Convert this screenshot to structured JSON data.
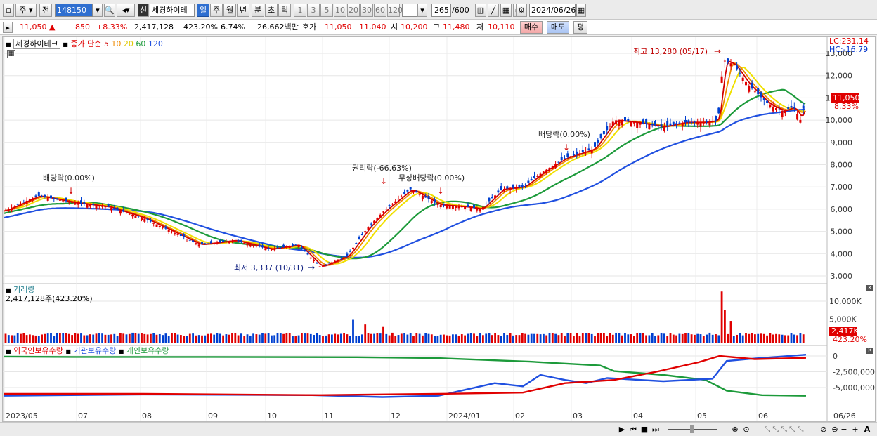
{
  "toolbar": {
    "period_main": "주",
    "prev_label": "전",
    "code": "148150",
    "credit_badge": "신",
    "stock_name": "세경하이테",
    "periods": [
      "일",
      "주",
      "월",
      "년",
      "분",
      "초",
      "틱"
    ],
    "selected_period": "일",
    "intervals": [
      "1",
      "3",
      "5",
      "10",
      "20",
      "30",
      "60",
      "120"
    ],
    "count": "265",
    "count_total": "/600",
    "date": "2024/06/26"
  },
  "quote": {
    "price": "11,050",
    "change": "850",
    "change_rate": "+8.33%",
    "volume": "2,417,128",
    "volume_rate": "423.20%",
    "turnover_rate": "6.74%",
    "amount": "26,662백만",
    "ask_label": "호가",
    "ask": "11,050",
    "bid": "11,040",
    "open_label": "시",
    "open": "10,200",
    "high_label": "고",
    "high": "11,480",
    "low_label": "저",
    "low": "10,110",
    "buy_label": "매수",
    "sell_label": "매도",
    "eval_label": "평"
  },
  "price_panel": {
    "stock_label": "세경하이테크",
    "ma_title": "종가 단순",
    "ma_periods": [
      "5",
      "10",
      "20",
      "60",
      "120"
    ],
    "lc_label": "LC:231.14",
    "hc_label": "HC:-16.79",
    "current_price": "11,050",
    "current_rate": "8.33%",
    "y_ticks": [
      "13,000",
      "12,000",
      "11,000",
      "10,000",
      "9,000",
      "8,000",
      "7,000",
      "6,000",
      "5,000",
      "4,000",
      "3,000"
    ],
    "annotations": {
      "high": "최고 13,280 (05/17)",
      "low": "최저 3,337 (10/31)",
      "div1": "배당락(0.00%)",
      "rights": "권리락(-66.63%)",
      "bonus": "무상배당락(0.00%)",
      "div2": "배당락(0.00%)"
    }
  },
  "volume_panel": {
    "title": "거래량",
    "value": "2,417,128주(423.20%)",
    "y_ticks": [
      "10,000K",
      "5,000K"
    ],
    "current": "2,417K",
    "current_rate": "423.20%"
  },
  "holding_panel": {
    "series_labels": [
      "외국인보유수량",
      "기관보유수량",
      "개인보유수량"
    ],
    "y_ticks": [
      "0",
      "-2,500,000",
      "-5,000,000"
    ]
  },
  "x_axis": {
    "labels": [
      "2023/05",
      "07",
      "08",
      "09",
      "10",
      "11",
      "12",
      "2024/01",
      "02",
      "03",
      "04",
      "05",
      "06",
      "06/26"
    ]
  },
  "colors": {
    "up": "#e00000",
    "down": "#0040d0",
    "ma5": "#d00000",
    "ma10": "#f08a00",
    "ma20": "#f0e000",
    "ma60": "#1c9a3a",
    "ma120": "#2050e0"
  }
}
